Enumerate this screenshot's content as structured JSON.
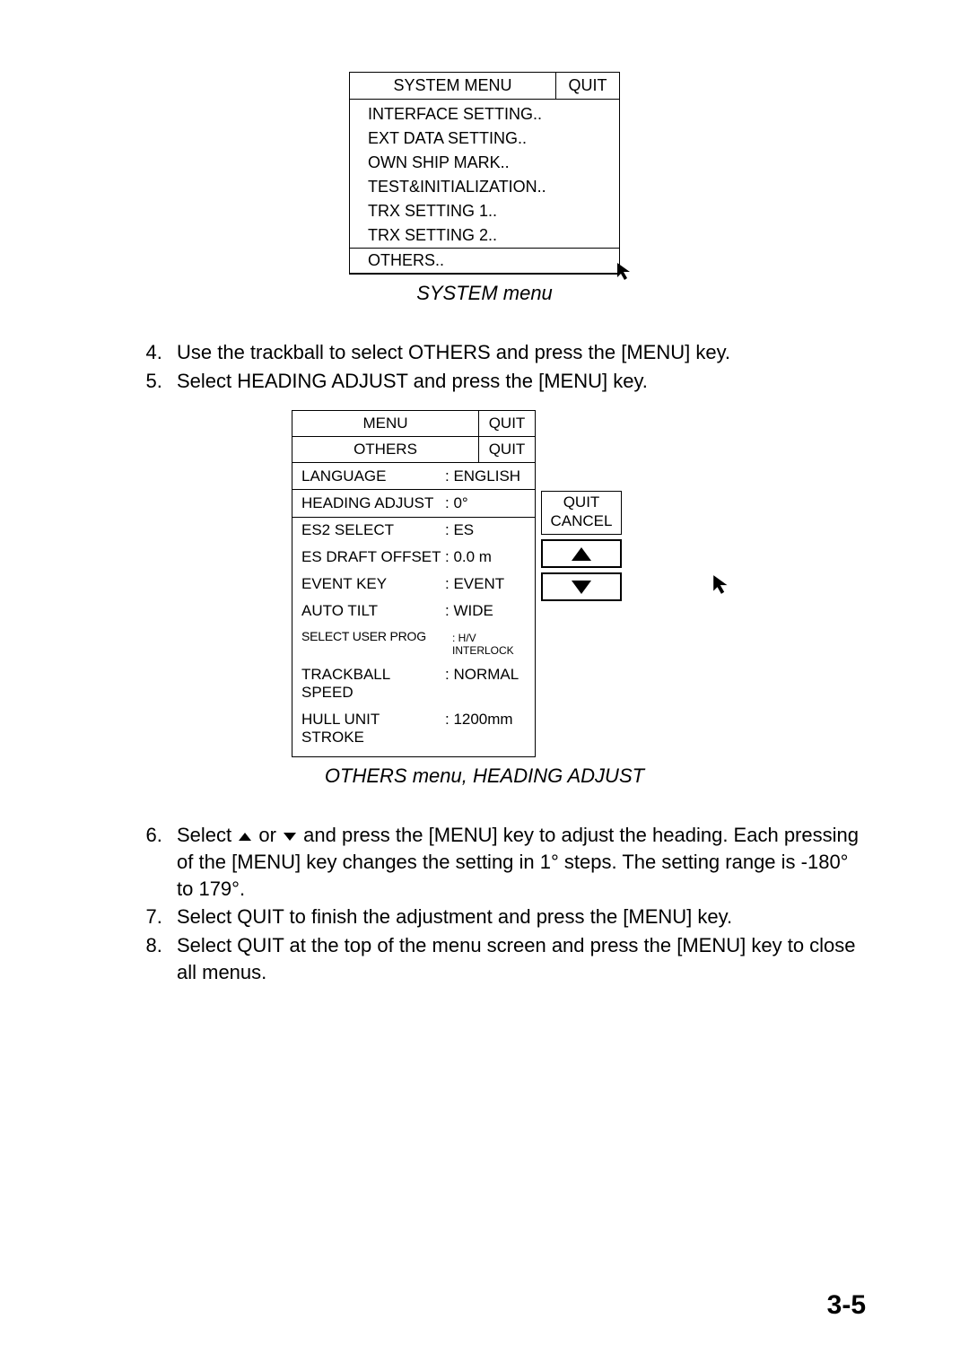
{
  "system_menu": {
    "title": "SYSTEM MENU",
    "quit": "QUIT",
    "items": [
      "INTERFACE SETTING..",
      "EXT DATA SETTING..",
      "OWN SHIP MARK..",
      "TEST&INITIALIZATION..",
      "TRX SETTING 1..",
      "TRX SETTING 2.."
    ],
    "selected": "OTHERS..",
    "caption": "SYSTEM menu"
  },
  "instructions_a": {
    "start": 4,
    "items": [
      "Use the trackball to select OTHERS and press the [MENU] key.",
      "Select HEADING ADJUST and press the [MENU] key."
    ]
  },
  "others_menu": {
    "top_title": "MENU",
    "top_quit": "QUIT",
    "sub_title": "OTHERS",
    "sub_quit": "QUIT",
    "rows": [
      {
        "label": "LANGUAGE",
        "value": ": ENGLISH"
      },
      {
        "label": "HEADING ADJUST",
        "value": ": 0°",
        "selected": true
      },
      {
        "label": "ES2  SELECT",
        "value": ": ES"
      },
      {
        "label": "ES DRAFT OFFSET",
        "value": ": 0.0 m"
      },
      {
        "label": "EVENT KEY",
        "value": ": EVENT"
      },
      {
        "label": "AUTO TILT",
        "value": ": WIDE"
      },
      {
        "label": "SELECT USER PROG",
        "value": ": H/V INTERLOCK",
        "small": true
      },
      {
        "label": "TRACKBALL SPEED",
        "value": ": NORMAL"
      },
      {
        "label": "HULL UNIT STROKE",
        "value": ": 1200mm"
      }
    ],
    "popup": {
      "quit": "QUIT",
      "cancel": "CANCEL"
    },
    "caption": "OTHERS menu, HEADING ADJUST"
  },
  "instructions_b": {
    "start": 6,
    "items": [
      {
        "pre": "Select ",
        "post": " and press the [MENU] key to adjust the heading. Each pressing of the [MENU] key changes the setting in 1° steps. The setting range is -180° to 179°.",
        "arrows": true,
        "or": " or "
      },
      {
        "text": "Select QUIT to finish the adjustment and press the [MENU] key."
      },
      {
        "text": "Select QUIT at the top of the menu screen and press the [MENU] key to close all menus."
      }
    ]
  },
  "page_number": "3-5"
}
